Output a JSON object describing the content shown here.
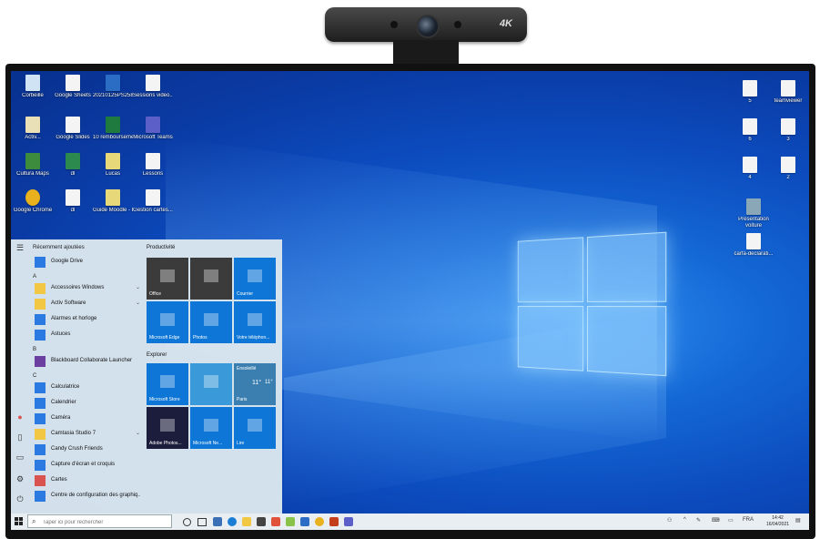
{
  "webcam": {
    "badge": "4K"
  },
  "desktop": {
    "left_icons": [
      {
        "label": "Corbeille",
        "icon": "recycle-bin-icon"
      },
      {
        "label": "Google Sheets",
        "icon": "doc-icon"
      },
      {
        "label": "20210125PS2581",
        "icon": "doc-icon"
      },
      {
        "label": "Sessions video...",
        "icon": "doc-icon"
      },
      {
        "label": "Activ...",
        "icon": "doc-icon"
      },
      {
        "label": "Google Slides",
        "icon": "doc-icon"
      },
      {
        "label": "10 remboursements",
        "icon": "excel-icon"
      },
      {
        "label": "Microsoft Teams",
        "icon": "teams-icon"
      },
      {
        "label": "Cultura Maps",
        "icon": "app-icon"
      },
      {
        "label": "dl",
        "icon": "doc-icon"
      },
      {
        "label": "Lucas",
        "icon": "doc-icon"
      },
      {
        "label": "Lessons",
        "icon": "doc-icon"
      },
      {
        "label": "Google Chrome",
        "icon": "chrome-icon"
      },
      {
        "label": "dl",
        "icon": "doc-icon"
      },
      {
        "label": "Guide Moodle - Directeur - Copy",
        "icon": "doc-icon"
      },
      {
        "label": "Gestion cartes...",
        "icon": "doc-icon"
      }
    ],
    "right_icons": [
      {
        "label": "5",
        "icon": "doc-icon"
      },
      {
        "label": "teamviewer",
        "icon": "doc-icon"
      },
      {
        "label": "6",
        "icon": "doc-icon"
      },
      {
        "label": "3",
        "icon": "doc-icon"
      },
      {
        "label": "4",
        "icon": "doc-icon"
      },
      {
        "label": "2",
        "icon": "doc-icon"
      },
      {
        "label": "Présentation voiture",
        "icon": "image-icon"
      },
      {
        "label": "carfa-declarati...",
        "icon": "doc-icon"
      }
    ]
  },
  "start_menu": {
    "recent_header": "Récemment ajoutées",
    "apps": [
      {
        "type": "app",
        "label": "Google Drive",
        "color": "#2a7ae2"
      },
      {
        "type": "letter",
        "label": "A"
      },
      {
        "type": "app",
        "label": "Accessoires Windows",
        "color": "#f2c744",
        "chevron": true
      },
      {
        "type": "app",
        "label": "Activ Software",
        "color": "#f2c744",
        "chevron": true
      },
      {
        "type": "app",
        "label": "Alarmes et horloge",
        "color": "#2a7ae2"
      },
      {
        "type": "app",
        "label": "Astuces",
        "color": "#2a7ae2"
      },
      {
        "type": "letter",
        "label": "B"
      },
      {
        "type": "app",
        "label": "Blackboard Collaborate Launcher",
        "color": "#6b3fa0"
      },
      {
        "type": "letter",
        "label": "C"
      },
      {
        "type": "app",
        "label": "Calculatrice",
        "color": "#2a7ae2"
      },
      {
        "type": "app",
        "label": "Calendrier",
        "color": "#2a7ae2"
      },
      {
        "type": "app",
        "label": "Caméra",
        "color": "#2a7ae2"
      },
      {
        "type": "app",
        "label": "Camtasia Studio 7",
        "color": "#f2c744",
        "chevron": true
      },
      {
        "type": "app",
        "label": "Candy Crush Friends",
        "color": "#2a7ae2"
      },
      {
        "type": "app",
        "label": "Capture d'écran et croquis",
        "color": "#2a7ae2"
      },
      {
        "type": "app",
        "label": "Cartes",
        "color": "#d9534f"
      },
      {
        "type": "app",
        "label": "Centre de configuration des graphiq...",
        "color": "#2a7ae2"
      }
    ],
    "groups": {
      "productivity": "Productivité",
      "explore": "Explorer"
    },
    "tiles": [
      {
        "label": "Office",
        "color": "#3b3b3b"
      },
      {
        "label": "",
        "color": "#3b3b3b"
      },
      {
        "label": "Courrier",
        "color": "#0d76d6"
      },
      {
        "label": "Microsoft Edge",
        "color": "#0d76d6"
      },
      {
        "label": "Photos",
        "color": "#0d76d6"
      },
      {
        "label": "Votre téléphon...",
        "color": "#0d76d6"
      },
      {
        "label": "Microsoft Store",
        "color": "#0d76d6"
      },
      {
        "label": "",
        "color": "#3a9ad9"
      },
      {
        "label": "Paris",
        "color": "#3a7fb0"
      },
      {
        "label": "Adobe Photos...",
        "color": "#1c1c3c"
      },
      {
        "label": "Microsoft Ne...",
        "color": "#0d76d6"
      },
      {
        "label": "Lire",
        "color": "#0d76d6"
      }
    ],
    "weather": {
      "label": "Ensoleillé",
      "temp1": "11°",
      "temp2": "11°"
    }
  },
  "taskbar": {
    "search_placeholder": "Taper ici pour rechercher",
    "lang": "FRA",
    "time": "14:42",
    "date": "16/04/2021"
  }
}
